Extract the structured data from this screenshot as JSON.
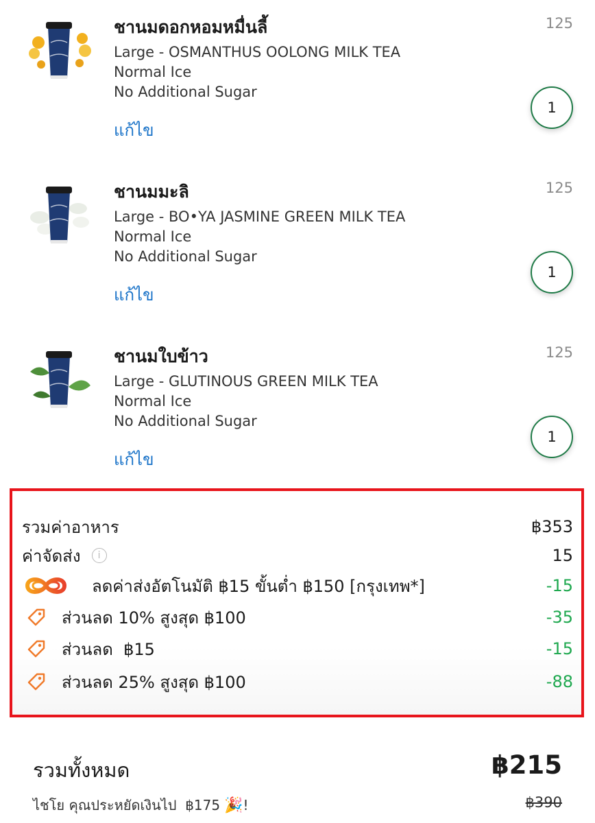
{
  "items": [
    {
      "name": "ชานมดอกหอมหมื่นลี้",
      "price": "125",
      "size": "Large - OSMANTHUS OOLONG MILK TEA",
      "ice": "Normal Ice",
      "sugar": "No Additional Sugar",
      "edit_label": "แก้ไข",
      "quantity": "1",
      "accent_color": "#f2b01e"
    },
    {
      "name": "ชานมมะลิ",
      "price": "125",
      "size": "Large - BO•YA JASMINE GREEN MILK TEA",
      "ice": "Normal Ice",
      "sugar": "No Additional Sugar",
      "edit_label": "แก้ไข",
      "quantity": "1",
      "accent_color": "#e9ede6"
    },
    {
      "name": "ชานมใบข้าว",
      "price": "125",
      "size": "Large - GLUTINOUS GREEN MILK TEA",
      "ice": "Normal Ice",
      "sugar": "No Additional Sugar",
      "edit_label": "แก้ไข",
      "quantity": "1",
      "accent_color": "#4e8f3a"
    }
  ],
  "summary": {
    "food_total_label": "รวมค่าอาหาร",
    "food_total_value": "฿353",
    "delivery_label": "ค่าจัดส่ง",
    "delivery_value": "15",
    "discounts": [
      {
        "label": "ลดค่าส่งอัตโนมัติ ฿15 ขั้นต่ำ ฿150 [กรุงเทพ*]",
        "value": "-15",
        "icon": "infinity-promo-icon"
      },
      {
        "label": "ส่วนลด 10% สูงสุด ฿100",
        "value": "-35",
        "icon": "tag-icon"
      },
      {
        "label": "ส่วนลด  ฿15",
        "value": "-15",
        "icon": "tag-icon"
      },
      {
        "label": "ส่วนลด 25% สูงสุด ฿100",
        "value": "-88",
        "icon": "tag-icon"
      }
    ]
  },
  "total": {
    "label": "รวมทั้งหมด",
    "value": "฿215",
    "saved_text": "ไชโย คุณประหยัดเงินไป  ฿175",
    "saved_suffix": "!",
    "original_value": "฿390"
  },
  "colors": {
    "link_blue": "#1a73c8",
    "discount_green": "#1fa84f",
    "qty_border": "#1e7a46",
    "highlight_red": "#e8141b",
    "tag_orange": "#f07a2a"
  }
}
